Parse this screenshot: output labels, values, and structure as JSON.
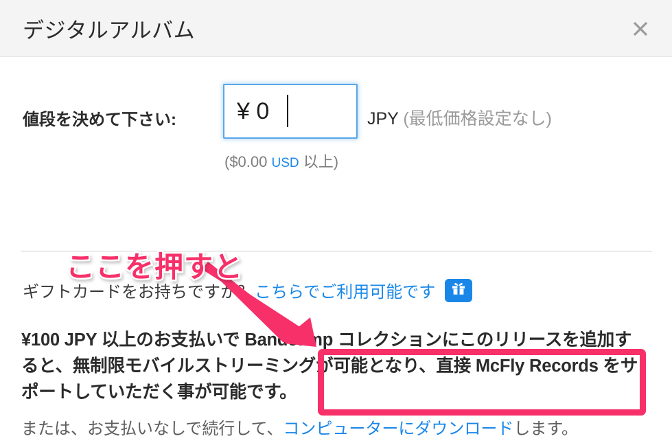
{
  "dialog": {
    "title": "デジタルアルバム",
    "close_icon": "close-icon"
  },
  "price": {
    "label": "値段を決めて下さい:",
    "input_value": "¥ 0",
    "input_placeholder": "¥ 0",
    "currency_code": "JPY",
    "currency_note": "(最低価格設定なし)",
    "converted_prefix": "($0.00",
    "converted_currency": "USD",
    "converted_suffix": "以上)"
  },
  "gift": {
    "question": "ギフトカードをお持ちですか？",
    "link": "こちらでご利用可能です",
    "badge_icon": "gift-icon"
  },
  "promo": {
    "text": "¥100 JPY 以上のお支払いで Bandcamp コレクションにこのリリースを追加すると、無制限モバイルストリーミングが可能となり、直接 McFly Records をサポートしていただく事が可能です。"
  },
  "alternative": {
    "prefix": "または、お支払いなしで続行して、",
    "link": "コンピューターにダウンロード",
    "suffix": "します。"
  },
  "annotation": {
    "text": "ここを押すと",
    "arrow_icon": "arrow-down-right-icon",
    "highlight_color": "#f7306a"
  },
  "colors": {
    "link": "#1a87e8",
    "header_bg": "#f4f4f4",
    "accent_pink": "#f7306a",
    "focus_blue": "#58a6e8"
  }
}
